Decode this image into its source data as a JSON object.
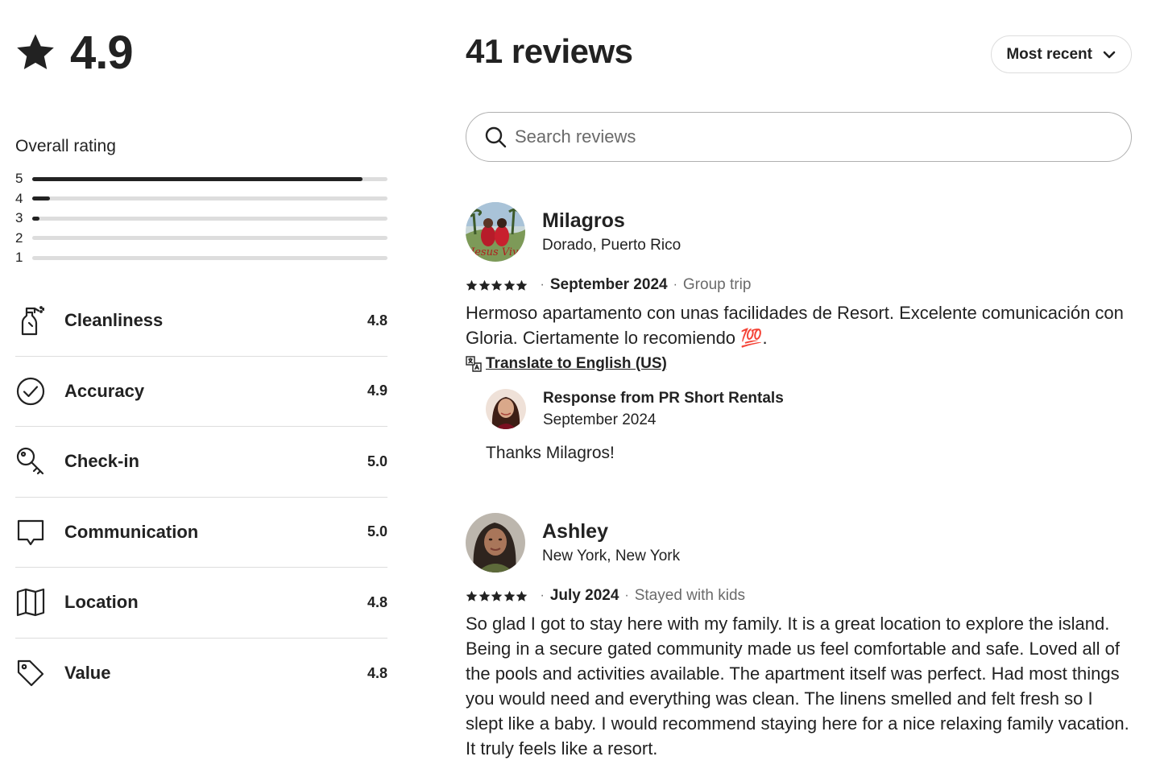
{
  "summary": {
    "overall_score": "4.9",
    "overall_rating_title": "Overall rating",
    "distribution": [
      {
        "label": "5",
        "fraction": 0.93
      },
      {
        "label": "4",
        "fraction": 0.05
      },
      {
        "label": "3",
        "fraction": 0.02
      },
      {
        "label": "2",
        "fraction": 0.0
      },
      {
        "label": "1",
        "fraction": 0.0
      }
    ],
    "categories": [
      {
        "name": "Cleanliness",
        "score": "4.8",
        "icon": "spray-bottle-icon"
      },
      {
        "name": "Accuracy",
        "score": "4.9",
        "icon": "check-circle-icon"
      },
      {
        "name": "Check-in",
        "score": "5.0",
        "icon": "key-icon"
      },
      {
        "name": "Communication",
        "score": "5.0",
        "icon": "chat-bubble-icon"
      },
      {
        "name": "Location",
        "score": "4.8",
        "icon": "map-icon"
      },
      {
        "name": "Value",
        "score": "4.8",
        "icon": "tag-icon"
      }
    ]
  },
  "reviews_header": {
    "title": "41 reviews",
    "sort_label": "Most recent",
    "search_placeholder": "Search reviews"
  },
  "reviews": [
    {
      "name": "Milagros",
      "location": "Dorado, Puerto Rico",
      "stars": 5,
      "date": "September 2024",
      "trip_type": "Group trip",
      "text": "Hermoso apartamento con unas facilidades de Resort. Excelente comunicación con Gloria. Ciertamente lo recomiendo 💯.",
      "translate_label": "Translate to English (US)",
      "response": {
        "title": "Response from PR Short Rentals",
        "date": "September 2024",
        "text": "Thanks Milagros!"
      }
    },
    {
      "name": "Ashley",
      "location": "New York, New York",
      "stars": 5,
      "date": "July 2024",
      "trip_type": "Stayed with kids",
      "text": "So glad I got to stay here with my family. It is a great location to explore the island. Being in a secure gated community made us feel comfortable and safe. Loved all of the pools and activities available. The apartment itself was perfect. Had most things you would need and everything was clean. The linens smelled and felt fresh so I slept like a baby. I would recommend staying here for a nice relaxing family vacation. It truly feels like a resort."
    }
  ],
  "colors": {
    "text": "#222222",
    "muted": "#6a6a6a",
    "bar_track": "#dddddd",
    "bar_fill": "#222222",
    "divider": "#dddddd"
  }
}
